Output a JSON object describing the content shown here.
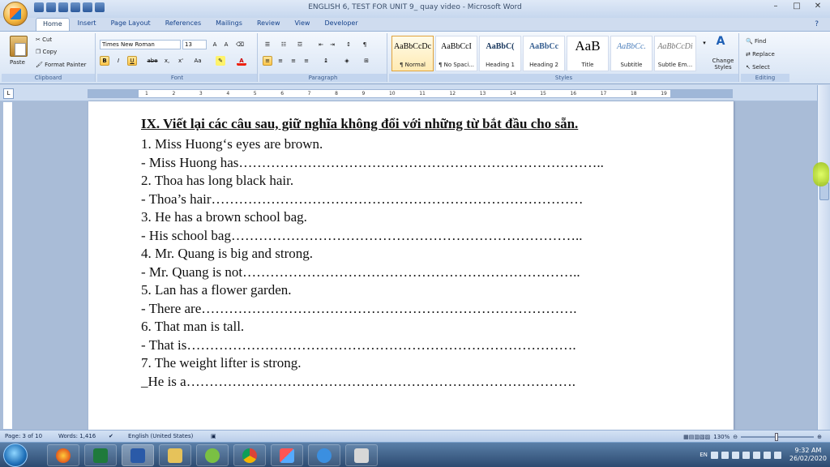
{
  "window": {
    "title": "ENGLISH 6, TEST FOR UNIT 9_ quay video - Microsoft Word",
    "controls": [
      "–",
      "□",
      "✕"
    ]
  },
  "tabs": [
    "Home",
    "Insert",
    "Page Layout",
    "References",
    "Mailings",
    "Review",
    "View",
    "Developer"
  ],
  "ribbon": {
    "clipboard": {
      "paste": "Paste",
      "cut": "Cut",
      "copy": "Copy",
      "format_painter": "Format Painter",
      "label": "Clipboard"
    },
    "font": {
      "name": "Times New Roman",
      "size": "13",
      "label": "Font",
      "bold": "B",
      "italic": "I",
      "underline": "U",
      "strike": "abe",
      "sub": "x,",
      "sup": "x'",
      "case": "Aa"
    },
    "paragraph": {
      "label": "Paragraph"
    },
    "styles": {
      "label": "Styles",
      "items": [
        {
          "sample": "AaBbCcDc",
          "name": "¶ Normal"
        },
        {
          "sample": "AaBbCcI",
          "name": "¶ No Spaci..."
        },
        {
          "sample": "AaBbC(",
          "name": "Heading 1"
        },
        {
          "sample": "AaBbCc",
          "name": "Heading 2"
        },
        {
          "sample": "AaB",
          "name": "Title"
        },
        {
          "sample": "AaBbCc.",
          "name": "Subtitle"
        },
        {
          "sample": "AaBbCcDi",
          "name": "Subtle Em..."
        }
      ],
      "change_styles": "Change Styles"
    },
    "editing": {
      "find": "Find",
      "replace": "Replace",
      "select": "Select",
      "label": "Editing"
    }
  },
  "ruler_numbers": [
    "1",
    "2",
    "3",
    "4",
    "5",
    "6",
    "7",
    "8",
    "9",
    "10",
    "11",
    "12",
    "13",
    "14",
    "15",
    "16",
    "17",
    "18",
    "19"
  ],
  "document": {
    "heading": "IX. Viết lại các câu sau, giữ nghĩa không đổi với những từ bắt đầu cho sẵn.",
    "lines": [
      "1. Miss Huong‘s eyes are brown.",
      "- Miss Huong has……………………………………………………………………..",
      "2. Thoa has long black hair.",
      "- Thoa’s hair………………………………………………………………………",
      "3. He has a brown school bag.",
      "- His school bag…………………………………………………………………..",
      "4. Mr. Quang is big and strong.",
      "- Mr. Quang is not………………………………………………………………..",
      "5. Lan has a flower garden.",
      "- There are……………………………………………………………………….",
      "6. That man is tall.",
      "- That is………………………………………………………………………….",
      "7. The weight lifter is strong.",
      "_He is a…………………………………………………………………………."
    ]
  },
  "status": {
    "page": "Page: 3 of 10",
    "words": "Words: 1,416",
    "language": "English (United States)",
    "zoom": "130%"
  },
  "taskbar": {
    "lang": "EN",
    "time": "9:32 AM",
    "date": "26/02/2020"
  }
}
